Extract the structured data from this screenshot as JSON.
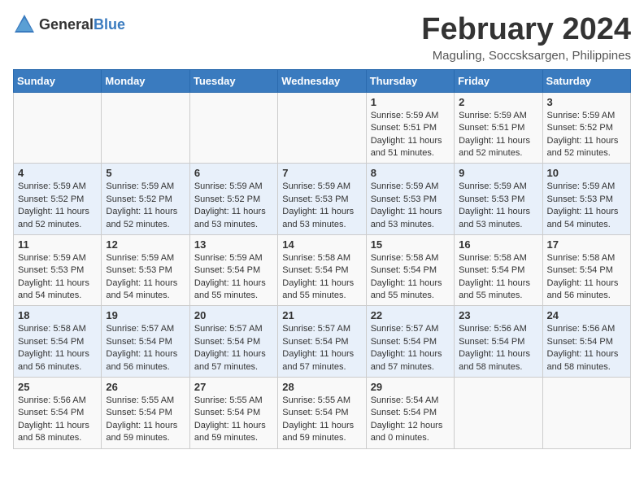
{
  "logo": {
    "general": "General",
    "blue": "Blue"
  },
  "title": "February 2024",
  "location": "Maguling, Soccsksargen, Philippines",
  "days_of_week": [
    "Sunday",
    "Monday",
    "Tuesday",
    "Wednesday",
    "Thursday",
    "Friday",
    "Saturday"
  ],
  "weeks": [
    [
      {
        "day": "",
        "info": ""
      },
      {
        "day": "",
        "info": ""
      },
      {
        "day": "",
        "info": ""
      },
      {
        "day": "",
        "info": ""
      },
      {
        "day": "1",
        "info": "Sunrise: 5:59 AM\nSunset: 5:51 PM\nDaylight: 11 hours and 51 minutes."
      },
      {
        "day": "2",
        "info": "Sunrise: 5:59 AM\nSunset: 5:51 PM\nDaylight: 11 hours and 52 minutes."
      },
      {
        "day": "3",
        "info": "Sunrise: 5:59 AM\nSunset: 5:52 PM\nDaylight: 11 hours and 52 minutes."
      }
    ],
    [
      {
        "day": "4",
        "info": "Sunrise: 5:59 AM\nSunset: 5:52 PM\nDaylight: 11 hours and 52 minutes."
      },
      {
        "day": "5",
        "info": "Sunrise: 5:59 AM\nSunset: 5:52 PM\nDaylight: 11 hours and 52 minutes."
      },
      {
        "day": "6",
        "info": "Sunrise: 5:59 AM\nSunset: 5:52 PM\nDaylight: 11 hours and 53 minutes."
      },
      {
        "day": "7",
        "info": "Sunrise: 5:59 AM\nSunset: 5:53 PM\nDaylight: 11 hours and 53 minutes."
      },
      {
        "day": "8",
        "info": "Sunrise: 5:59 AM\nSunset: 5:53 PM\nDaylight: 11 hours and 53 minutes."
      },
      {
        "day": "9",
        "info": "Sunrise: 5:59 AM\nSunset: 5:53 PM\nDaylight: 11 hours and 53 minutes."
      },
      {
        "day": "10",
        "info": "Sunrise: 5:59 AM\nSunset: 5:53 PM\nDaylight: 11 hours and 54 minutes."
      }
    ],
    [
      {
        "day": "11",
        "info": "Sunrise: 5:59 AM\nSunset: 5:53 PM\nDaylight: 11 hours and 54 minutes."
      },
      {
        "day": "12",
        "info": "Sunrise: 5:59 AM\nSunset: 5:53 PM\nDaylight: 11 hours and 54 minutes."
      },
      {
        "day": "13",
        "info": "Sunrise: 5:59 AM\nSunset: 5:54 PM\nDaylight: 11 hours and 55 minutes."
      },
      {
        "day": "14",
        "info": "Sunrise: 5:58 AM\nSunset: 5:54 PM\nDaylight: 11 hours and 55 minutes."
      },
      {
        "day": "15",
        "info": "Sunrise: 5:58 AM\nSunset: 5:54 PM\nDaylight: 11 hours and 55 minutes."
      },
      {
        "day": "16",
        "info": "Sunrise: 5:58 AM\nSunset: 5:54 PM\nDaylight: 11 hours and 55 minutes."
      },
      {
        "day": "17",
        "info": "Sunrise: 5:58 AM\nSunset: 5:54 PM\nDaylight: 11 hours and 56 minutes."
      }
    ],
    [
      {
        "day": "18",
        "info": "Sunrise: 5:58 AM\nSunset: 5:54 PM\nDaylight: 11 hours and 56 minutes."
      },
      {
        "day": "19",
        "info": "Sunrise: 5:57 AM\nSunset: 5:54 PM\nDaylight: 11 hours and 56 minutes."
      },
      {
        "day": "20",
        "info": "Sunrise: 5:57 AM\nSunset: 5:54 PM\nDaylight: 11 hours and 57 minutes."
      },
      {
        "day": "21",
        "info": "Sunrise: 5:57 AM\nSunset: 5:54 PM\nDaylight: 11 hours and 57 minutes."
      },
      {
        "day": "22",
        "info": "Sunrise: 5:57 AM\nSunset: 5:54 PM\nDaylight: 11 hours and 57 minutes."
      },
      {
        "day": "23",
        "info": "Sunrise: 5:56 AM\nSunset: 5:54 PM\nDaylight: 11 hours and 58 minutes."
      },
      {
        "day": "24",
        "info": "Sunrise: 5:56 AM\nSunset: 5:54 PM\nDaylight: 11 hours and 58 minutes."
      }
    ],
    [
      {
        "day": "25",
        "info": "Sunrise: 5:56 AM\nSunset: 5:54 PM\nDaylight: 11 hours and 58 minutes."
      },
      {
        "day": "26",
        "info": "Sunrise: 5:55 AM\nSunset: 5:54 PM\nDaylight: 11 hours and 59 minutes."
      },
      {
        "day": "27",
        "info": "Sunrise: 5:55 AM\nSunset: 5:54 PM\nDaylight: 11 hours and 59 minutes."
      },
      {
        "day": "28",
        "info": "Sunrise: 5:55 AM\nSunset: 5:54 PM\nDaylight: 11 hours and 59 minutes."
      },
      {
        "day": "29",
        "info": "Sunrise: 5:54 AM\nSunset: 5:54 PM\nDaylight: 12 hours and 0 minutes."
      },
      {
        "day": "",
        "info": ""
      },
      {
        "day": "",
        "info": ""
      }
    ]
  ]
}
